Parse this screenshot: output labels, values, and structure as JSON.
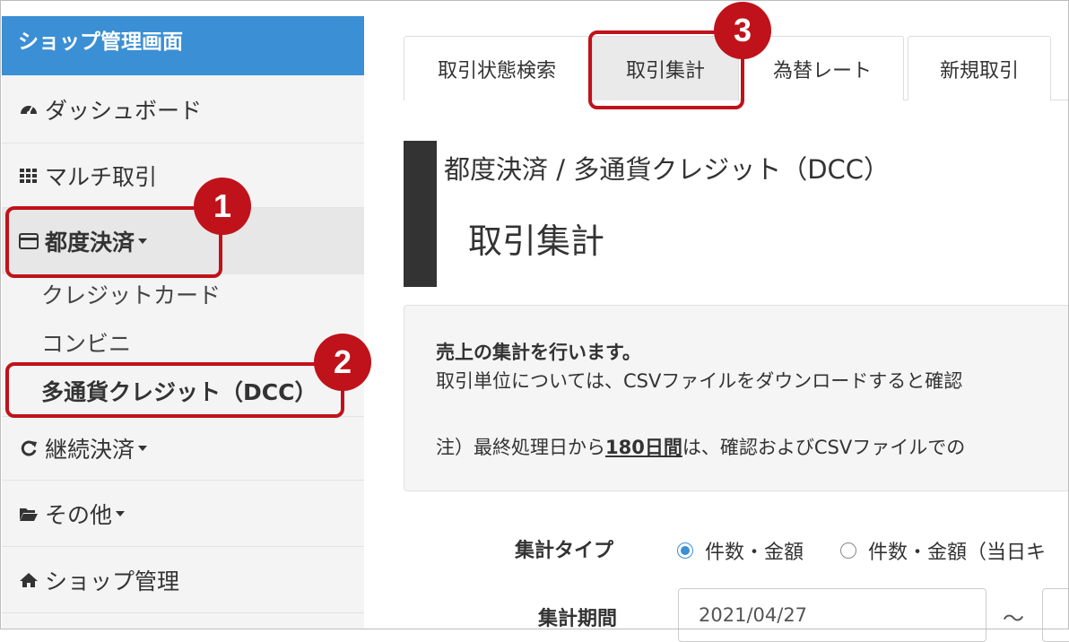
{
  "sidebar": {
    "header": "ショップ管理画面",
    "items": [
      {
        "label": "ダッシュボード",
        "icon": "dashboard-icon"
      },
      {
        "label": "マルチ取引",
        "icon": "grid-icon"
      },
      {
        "label": "都度決済",
        "icon": "credit-card-icon"
      },
      {
        "label": "継続決済",
        "icon": "refresh-icon"
      },
      {
        "label": "その他",
        "icon": "folder-open-icon"
      },
      {
        "label": "ショップ管理",
        "icon": "home-icon"
      }
    ],
    "sub_items": [
      "クレジットカード",
      "コンビニ",
      "多通貨クレジット（DCC）"
    ]
  },
  "tabs": [
    "取引状態検索",
    "取引集計",
    "為替レート",
    "新規取引"
  ],
  "active_tab": "取引集計",
  "main": {
    "breadcrumb": "都度決済 / 多通貨クレジット（DCC）",
    "title": "取引集計",
    "info": {
      "heading": "売上の集計を行います。",
      "line1": "取引単位については、CSVファイルをダウンロードすると確認",
      "note_prefix": "注）最終処理日から",
      "note_emph": "180日間",
      "note_suffix": "は、確認およびCSVファイルでの"
    },
    "form": {
      "type_label": "集計タイプ",
      "type_option1": "件数・金額",
      "type_option2": "件数・金額（当日キ",
      "period_label": "集計期間",
      "period_from": "2021/04/27",
      "tilde": "～"
    }
  },
  "annotations": [
    "1",
    "2",
    "3"
  ],
  "colors": {
    "accent": "#3b8fd4",
    "highlight": "#c0121a",
    "title_bar": "#333333"
  }
}
